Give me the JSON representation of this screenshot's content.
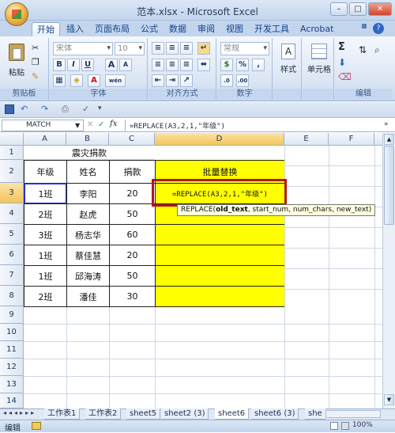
{
  "window": {
    "title": "范本.xlsx - Microsoft Excel",
    "min": "–",
    "max": "□",
    "close": "✕"
  },
  "tabs": [
    "开始",
    "插入",
    "页面布局",
    "公式",
    "数据",
    "审阅",
    "视图",
    "开发工具",
    "Acrobat"
  ],
  "help": "?",
  "ribbon": {
    "clipboard": {
      "label": "剪贴板",
      "paste": "粘贴"
    },
    "font": {
      "label": "字体",
      "name": "宋体",
      "size": "10",
      "bold": "B",
      "italic": "I",
      "underline": "U",
      "grow": "A",
      "shrink": "A",
      "wen": "wén"
    },
    "align": {
      "label": "对齐方式"
    },
    "number": {
      "label": "数字",
      "format": "常规",
      "pct": "%",
      "comma": ","
    },
    "styles": {
      "label": "样式"
    },
    "cells": {
      "label": "单元格"
    },
    "edit": {
      "label": "编辑"
    }
  },
  "formula_bar": {
    "name_box": "MATCH",
    "fx": "fx",
    "formula": "=REPLACE(A3,2,1,\"年级\")"
  },
  "columns": [
    "A",
    "B",
    "C",
    "D",
    "E",
    "F"
  ],
  "rows": [
    "1",
    "2",
    "3",
    "4",
    "5",
    "6",
    "7",
    "8",
    "9",
    "10",
    "11",
    "12",
    "13",
    "14"
  ],
  "sheet": {
    "title": "震灾捐款",
    "headers": [
      "年级",
      "姓名",
      "捐款"
    ],
    "replace_header": "批量替换",
    "editing_cell": "=REPLACE(A3,2,1,\"年级\")",
    "data": [
      [
        "1班",
        "李阳",
        "20"
      ],
      [
        "2班",
        "赵虎",
        "50"
      ],
      [
        "3班",
        "杨志华",
        "60"
      ],
      [
        "1班",
        "蔡佳慧",
        "20"
      ],
      [
        "1班",
        "邱海涛",
        "50"
      ],
      [
        "2班",
        "潘佳",
        "30"
      ]
    ]
  },
  "tooltip": {
    "fn": "REPLACE(",
    "arg1": "old_text",
    ", ": ", ",
    "rest": ", start_num, num_chars, new_text)"
  },
  "sheet_tabs": [
    "工作表1",
    "工作表2",
    "sheet5",
    "sheet2 (3)",
    "sheet6",
    "sheet6 (3)",
    "she"
  ],
  "status": {
    "mode": "编辑",
    "zoom": "100%"
  }
}
